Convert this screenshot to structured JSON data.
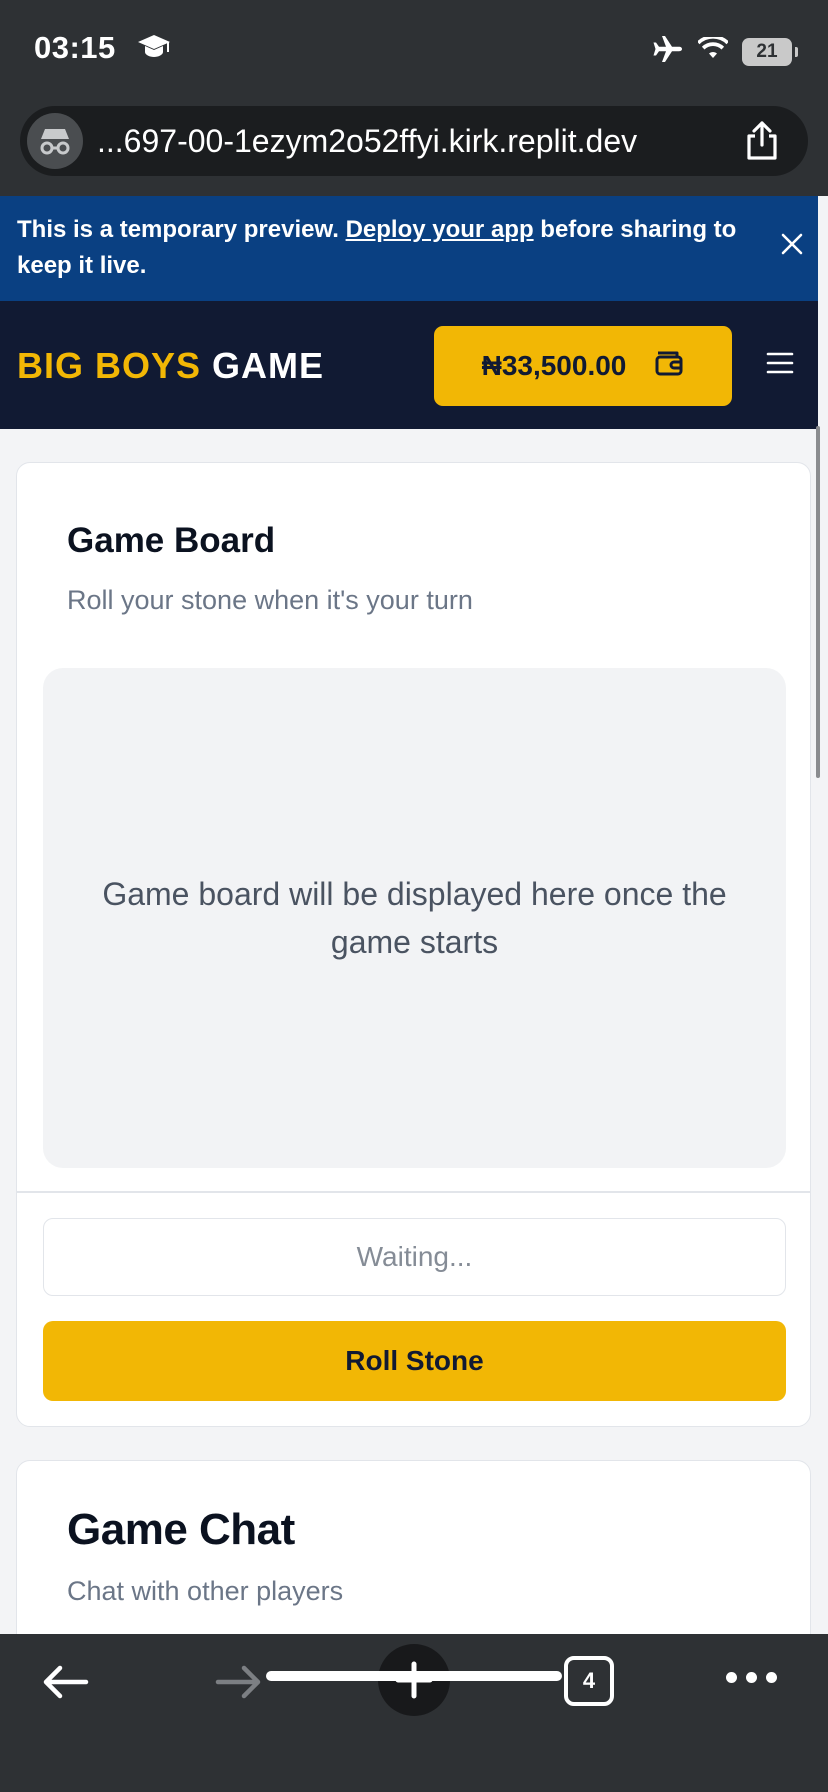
{
  "status_bar": {
    "time": "03:15",
    "battery": "21",
    "icons": [
      "graduation-cap-icon",
      "airplane-icon",
      "wifi-icon",
      "battery-icon"
    ]
  },
  "browser": {
    "url": "...697-00-1ezym2o52ffyi.kirk.replit.dev",
    "tab_count": "4",
    "icons": [
      "incognito-icon",
      "share-icon",
      "back-arrow-icon",
      "forward-arrow-icon",
      "plus-icon",
      "more-icon"
    ]
  },
  "banner": {
    "text_before": "This is a temporary preview. ",
    "link": "Deploy your app",
    "text_after": " before sharing to keep it live.",
    "background": "#0a4082"
  },
  "header": {
    "logo_part1": "BIG BOYS",
    "logo_part2": " GAME",
    "wallet_balance": "₦33,500.00",
    "accent": "#f2b705",
    "background": "#111a33"
  },
  "game_board": {
    "title": "Game Board",
    "subtitle": "Roll your stone when it's your turn",
    "placeholder": "Game board will be displayed here once the game starts",
    "status": "Waiting...",
    "roll_button": "Roll Stone"
  },
  "game_chat": {
    "title": "Game Chat",
    "subtitle": "Chat with other players"
  }
}
